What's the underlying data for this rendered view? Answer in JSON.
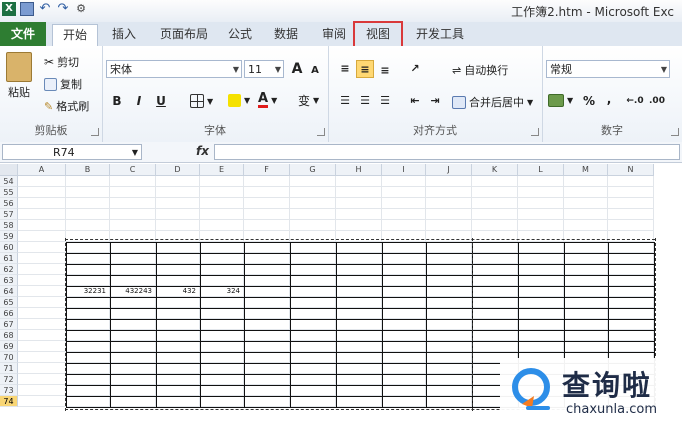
{
  "title_bar": {
    "title": "工作簿2.htm - Microsoft Exc"
  },
  "tabs": [
    {
      "label": "文件"
    },
    {
      "label": "开始"
    },
    {
      "label": "插入"
    },
    {
      "label": "页面布局"
    },
    {
      "label": "公式"
    },
    {
      "label": "数据"
    },
    {
      "label": "审阅"
    },
    {
      "label": "视图"
    },
    {
      "label": "开发工具"
    }
  ],
  "clipboard": {
    "paste": "粘贴",
    "cut": "剪切",
    "copy": "复制",
    "format_painter": "格式刷",
    "label": "剪贴板"
  },
  "font": {
    "name": "宋体",
    "size": "11",
    "label": "字体",
    "bold": "B",
    "italic": "I",
    "underline": "U",
    "grow": "A",
    "shrink": "A",
    "phonetic": "变"
  },
  "alignment": {
    "wrap": "自动换行",
    "merge": "合并后居中",
    "label": "对齐方式"
  },
  "number": {
    "format": "常规",
    "percent": "%",
    "comma": ",",
    "label": "数字"
  },
  "formula_bar": {
    "name_box": "R74",
    "fx": "fx",
    "content": ""
  },
  "columns": [
    "A",
    "B",
    "C",
    "D",
    "E",
    "F",
    "G",
    "H",
    "I",
    "J",
    "K",
    "L",
    "M",
    "N"
  ],
  "rows": [
    "54",
    "55",
    "56",
    "57",
    "58",
    "59",
    "60",
    "61",
    "62",
    "63",
    "64",
    "65",
    "66",
    "67",
    "68",
    "69",
    "70",
    "71",
    "72",
    "73",
    "74"
  ],
  "selected_row": "74",
  "cells": [
    {
      "row": "64",
      "col": "B",
      "value": "32231"
    },
    {
      "row": "64",
      "col": "C",
      "value": "432243"
    },
    {
      "row": "64",
      "col": "D",
      "value": "432"
    },
    {
      "row": "64",
      "col": "E",
      "value": "324"
    }
  ],
  "watermark": {
    "main": "查询啦",
    "sub": "chaxunla.com"
  },
  "colors": {
    "file_tab": "#2e7d32",
    "highlight": "#d9393a",
    "selected_row": "#f9d675"
  }
}
